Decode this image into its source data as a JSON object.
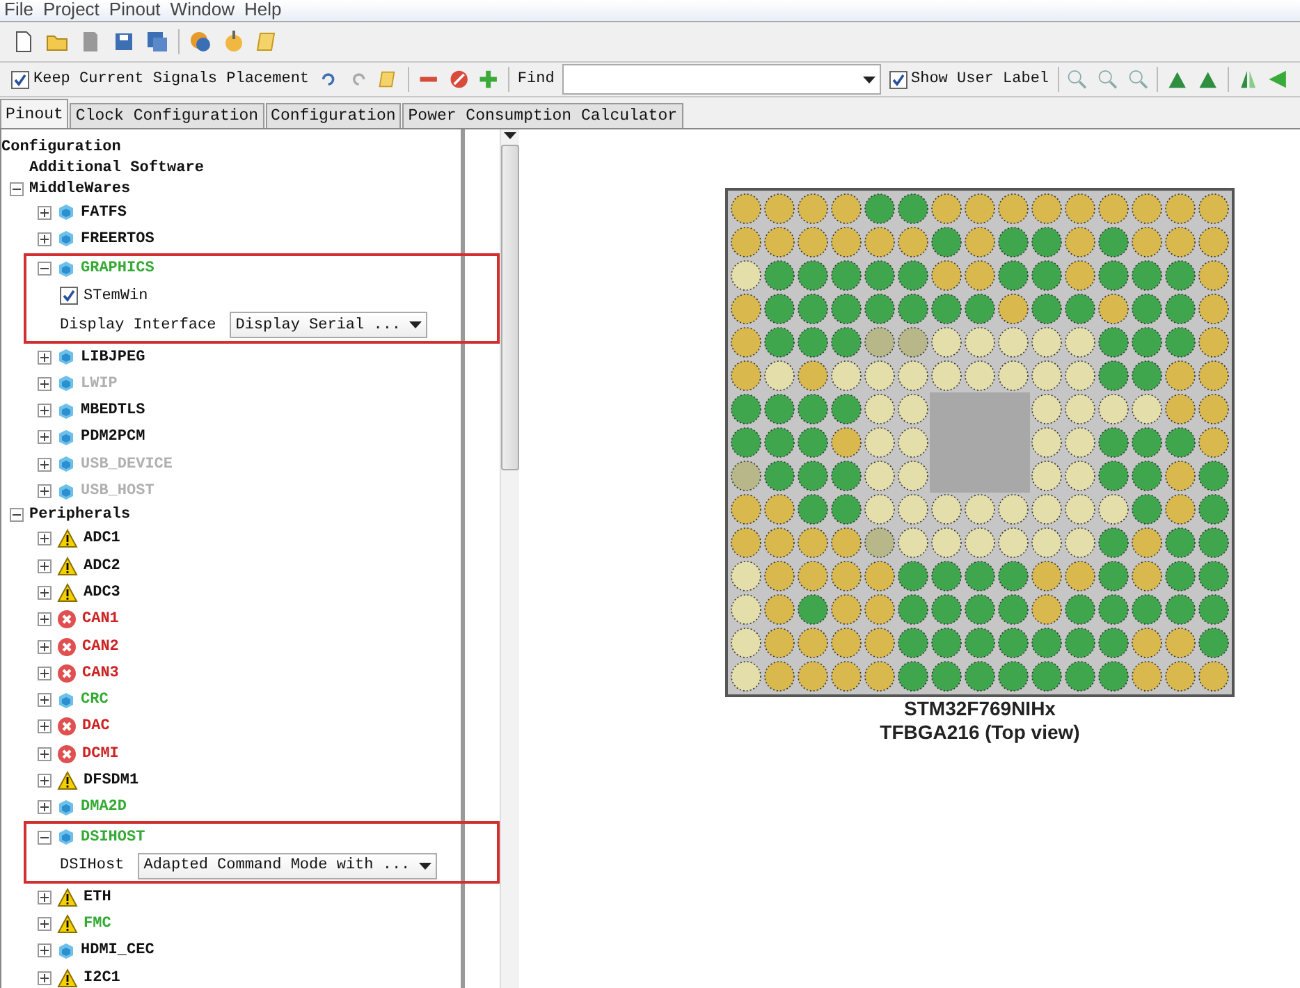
{
  "menu": [
    "File",
    "Project",
    "Pinout",
    "Window",
    "Help"
  ],
  "toolbar": {
    "keep_signals": {
      "label": "Keep Current Signals Placement",
      "checked": true
    },
    "find_label": "Find",
    "show_user_label": {
      "label": "Show User Label",
      "checked": true
    }
  },
  "tabs": [
    {
      "label": "Pinout",
      "selected": true
    },
    {
      "label": "Clock Configuration",
      "selected": false
    },
    {
      "label": "Configuration",
      "selected": false
    },
    {
      "label": "Power Consumption Calculator",
      "selected": false
    }
  ],
  "tree": [
    {
      "label": "Configuration",
      "children": [
        {
          "label": "Additional Software"
        },
        {
          "label": "MiddleWares",
          "expanded": true,
          "children": [
            {
              "label": "FATFS",
              "kind": "cube",
              "color": "#111111",
              "expanded": false
            },
            {
              "label": "FREERTOS",
              "kind": "cube",
              "color": "#111111",
              "expanded": false
            },
            {
              "label": "GRAPHICS",
              "kind": "cube",
              "color": "#33aa33",
              "expanded": true,
              "highlighted": true,
              "children": [
                {
                  "kind": "checkbox",
                  "label": "STemWin",
                  "checked": true
                },
                {
                  "kind": "dropdown",
                  "label": "Display Interface",
                  "value": "Display Serial ..."
                }
              ]
            },
            {
              "label": "LIBJPEG",
              "kind": "cube",
              "color": "#111111",
              "expanded": false
            },
            {
              "label": "LWIP",
              "kind": "cube",
              "color": "#b0b0b0",
              "expanded": false
            },
            {
              "label": "MBEDTLS",
              "kind": "cube",
              "color": "#111111",
              "expanded": false
            },
            {
              "label": "PDM2PCM",
              "kind": "cube",
              "color": "#111111",
              "expanded": false
            },
            {
              "label": "USB_DEVICE",
              "kind": "cube",
              "color": "#b0b0b0",
              "expanded": false
            },
            {
              "label": "USB_HOST",
              "kind": "cube",
              "color": "#b0b0b0",
              "expanded": false
            }
          ]
        },
        {
          "label": "Peripherals",
          "expanded": true,
          "children": [
            {
              "label": "ADC1",
              "kind": "warning",
              "color": "#111111",
              "expanded": false
            },
            {
              "label": "ADC2",
              "kind": "warning",
              "color": "#111111",
              "expanded": false
            },
            {
              "label": "ADC3",
              "kind": "warning",
              "color": "#111111",
              "expanded": false
            },
            {
              "label": "CAN1",
              "kind": "error",
              "color": "#cc2222",
              "expanded": false
            },
            {
              "label": "CAN2",
              "kind": "error",
              "color": "#cc2222",
              "expanded": false
            },
            {
              "label": "CAN3",
              "kind": "error",
              "color": "#cc2222",
              "expanded": false
            },
            {
              "label": "CRC",
              "kind": "cube",
              "color": "#33aa33",
              "expanded": false
            },
            {
              "label": "DAC",
              "kind": "error",
              "color": "#cc2222",
              "expanded": false
            },
            {
              "label": "DCMI",
              "kind": "error",
              "color": "#cc2222",
              "expanded": false
            },
            {
              "label": "DFSDM1",
              "kind": "warning",
              "color": "#111111",
              "expanded": false
            },
            {
              "label": "DMA2D",
              "kind": "cube",
              "color": "#33aa33",
              "expanded": false
            },
            {
              "label": "DSIHOST",
              "kind": "cube",
              "color": "#33aa33",
              "expanded": true,
              "highlighted": true,
              "children": [
                {
                  "kind": "dropdown",
                  "label": "DSIHost",
                  "value": "Adapted Command Mode with ..."
                }
              ]
            },
            {
              "label": "ETH",
              "kind": "warning",
              "color": "#111111",
              "expanded": false
            },
            {
              "label": "FMC",
              "kind": "warning",
              "color": "#33aa33",
              "expanded": false
            },
            {
              "label": "HDMI_CEC",
              "kind": "cube",
              "color": "#111111",
              "expanded": false
            },
            {
              "label": "I2C1",
              "kind": "warning",
              "color": "#111111",
              "expanded": false
            }
          ]
        }
      ]
    }
  ],
  "chip": {
    "pins": [
      [
        {
          "kind": "pin",
          "color": "#d9b84e"
        },
        {
          "kind": "pin",
          "color": "#d9b84e"
        },
        {
          "kind": "pin",
          "color": "#d9b84e"
        },
        {
          "kind": "pin",
          "color": "#d9b84e"
        },
        {
          "kind": "pin",
          "color": "#3fa64e"
        },
        {
          "kind": "pin",
          "color": "#3fa64e"
        },
        {
          "kind": "pin",
          "color": "#d9b84e"
        },
        {
          "kind": "pin",
          "color": "#d9b84e"
        },
        {
          "kind": "pin",
          "color": "#d9b84e"
        },
        {
          "kind": "pin",
          "color": "#d9b84e"
        },
        {
          "kind": "pin",
          "color": "#d9b84e"
        },
        {
          "kind": "pin",
          "color": "#d9b84e"
        },
        {
          "kind": "pin",
          "color": "#d9b84e"
        },
        {
          "kind": "pin",
          "color": "#d9b84e"
        },
        {
          "kind": "pin",
          "color": "#d9b84e"
        }
      ],
      [
        {
          "kind": "pin",
          "color": "#d9b84e"
        },
        {
          "kind": "pin",
          "color": "#d9b84e"
        },
        {
          "kind": "pin",
          "color": "#d9b84e"
        },
        {
          "kind": "pin",
          "color": "#d9b84e"
        },
        {
          "kind": "pin",
          "color": "#d9b84e"
        },
        {
          "kind": "pin",
          "color": "#d9b84e"
        },
        {
          "kind": "pin",
          "color": "#3fa64e"
        },
        {
          "kind": "pin",
          "color": "#d9b84e"
        },
        {
          "kind": "pin",
          "color": "#3fa64e"
        },
        {
          "kind": "pin",
          "color": "#3fa64e"
        },
        {
          "kind": "pin",
          "color": "#d9b84e"
        },
        {
          "kind": "pin",
          "color": "#3fa64e"
        },
        {
          "kind": "pin",
          "color": "#d9b84e"
        },
        {
          "kind": "pin",
          "color": "#d9b84e"
        },
        {
          "kind": "pin",
          "color": "#d9b84e"
        }
      ],
      [
        {
          "kind": "pin",
          "color": "#e3deaa"
        },
        {
          "kind": "pin",
          "color": "#3fa64e"
        },
        {
          "kind": "pin",
          "color": "#3fa64e"
        },
        {
          "kind": "pin",
          "color": "#3fa64e"
        },
        {
          "kind": "pin",
          "color": "#3fa64e"
        },
        {
          "kind": "pin",
          "color": "#3fa64e"
        },
        {
          "kind": "pin",
          "color": "#d9b84e"
        },
        {
          "kind": "pin",
          "color": "#d9b84e"
        },
        {
          "kind": "pin",
          "color": "#3fa64e"
        },
        {
          "kind": "pin",
          "color": "#3fa64e"
        },
        {
          "kind": "pin",
          "color": "#d9b84e"
        },
        {
          "kind": "pin",
          "color": "#3fa64e"
        },
        {
          "kind": "pin",
          "color": "#3fa64e"
        },
        {
          "kind": "pin",
          "color": "#3fa64e"
        },
        {
          "kind": "pin",
          "color": "#d9b84e"
        }
      ],
      [
        {
          "kind": "pin",
          "color": "#d9b84e"
        },
        {
          "kind": "pin",
          "color": "#3fa64e"
        },
        {
          "kind": "pin",
          "color": "#3fa64e"
        },
        {
          "kind": "pin",
          "color": "#3fa64e"
        },
        {
          "kind": "pin",
          "color": "#3fa64e"
        },
        {
          "kind": "pin",
          "color": "#3fa64e"
        },
        {
          "kind": "pin",
          "color": "#3fa64e"
        },
        {
          "kind": "pin",
          "color": "#3fa64e"
        },
        {
          "kind": "pin",
          "color": "#d9b84e"
        },
        {
          "kind": "pin",
          "color": "#3fa64e"
        },
        {
          "kind": "pin",
          "color": "#3fa64e"
        },
        {
          "kind": "pin",
          "color": "#d9b84e"
        },
        {
          "kind": "pin",
          "color": "#3fa64e"
        },
        {
          "kind": "pin",
          "color": "#3fa64e"
        },
        {
          "kind": "pin",
          "color": "#d9b84e"
        }
      ],
      [
        {
          "kind": "pin",
          "color": "#d9b84e"
        },
        {
          "kind": "pin",
          "color": "#3fa64e"
        },
        {
          "kind": "pin",
          "color": "#3fa64e"
        },
        {
          "kind": "pin",
          "color": "#3fa64e"
        },
        {
          "kind": "pin",
          "color": "#b7b78a"
        },
        {
          "kind": "pin",
          "color": "#b7b78a"
        },
        {
          "kind": "pin",
          "color": "#e3deaa"
        },
        {
          "kind": "pin",
          "color": "#e3deaa"
        },
        {
          "kind": "pin",
          "color": "#e3deaa"
        },
        {
          "kind": "pin",
          "color": "#e3deaa"
        },
        {
          "kind": "pin",
          "color": "#e3deaa"
        },
        {
          "kind": "pin",
          "color": "#3fa64e"
        },
        {
          "kind": "pin",
          "color": "#3fa64e"
        },
        {
          "kind": "pin",
          "color": "#3fa64e"
        },
        {
          "kind": "pin",
          "color": "#d9b84e"
        }
      ],
      [
        {
          "kind": "pin",
          "color": "#d9b84e"
        },
        {
          "kind": "pin",
          "color": "#e3deaa"
        },
        {
          "kind": "pin",
          "color": "#d9b84e"
        },
        {
          "kind": "pin",
          "color": "#e3deaa"
        },
        {
          "kind": "pin",
          "color": "#e3deaa"
        },
        {
          "kind": "pin",
          "color": "#e3deaa"
        },
        {
          "kind": "pin",
          "color": "#e3deaa"
        },
        {
          "kind": "pin",
          "color": "#e3deaa"
        },
        {
          "kind": "pin",
          "color": "#e3deaa"
        },
        {
          "kind": "pin",
          "color": "#e3deaa"
        },
        {
          "kind": "pin",
          "color": "#e3deaa"
        },
        {
          "kind": "pin",
          "color": "#3fa64e"
        },
        {
          "kind": "pin",
          "color": "#3fa64e"
        },
        {
          "kind": "pin",
          "color": "#d9b84e"
        },
        {
          "kind": "pin",
          "color": "#d9b84e"
        }
      ],
      [
        {
          "kind": "pin",
          "color": "#3fa64e"
        },
        {
          "kind": "pin",
          "color": "#3fa64e"
        },
        {
          "kind": "pin",
          "color": "#3fa64e"
        },
        {
          "kind": "pin",
          "color": "#3fa64e"
        },
        {
          "kind": "pin",
          "color": "#e3deaa"
        },
        {
          "kind": "pin",
          "color": "#e3deaa"
        },
        {
          "kind": "gap"
        },
        {
          "kind": "gap"
        },
        {
          "kind": "gap"
        },
        {
          "kind": "pin",
          "color": "#e3deaa"
        },
        {
          "kind": "pin",
          "color": "#e3deaa"
        },
        {
          "kind": "pin",
          "color": "#e3deaa"
        },
        {
          "kind": "pin",
          "color": "#e3deaa"
        },
        {
          "kind": "pin",
          "color": "#d9b84e"
        },
        {
          "kind": "pin",
          "color": "#d9b84e"
        }
      ],
      [
        {
          "kind": "pin",
          "color": "#3fa64e"
        },
        {
          "kind": "pin",
          "color": "#3fa64e"
        },
        {
          "kind": "pin",
          "color": "#3fa64e"
        },
        {
          "kind": "pin",
          "color": "#d9b84e"
        },
        {
          "kind": "pin",
          "color": "#e3deaa"
        },
        {
          "kind": "pin",
          "color": "#e3deaa"
        },
        {
          "kind": "gap"
        },
        {
          "kind": "gap"
        },
        {
          "kind": "gap"
        },
        {
          "kind": "pin",
          "color": "#e3deaa"
        },
        {
          "kind": "pin",
          "color": "#e3deaa"
        },
        {
          "kind": "pin",
          "color": "#3fa64e"
        },
        {
          "kind": "pin",
          "color": "#3fa64e"
        },
        {
          "kind": "pin",
          "color": "#3fa64e"
        },
        {
          "kind": "pin",
          "color": "#d9b84e"
        }
      ],
      [
        {
          "kind": "pin",
          "color": "#b7b78a"
        },
        {
          "kind": "pin",
          "color": "#3fa64e"
        },
        {
          "kind": "pin",
          "color": "#3fa64e"
        },
        {
          "kind": "pin",
          "color": "#3fa64e"
        },
        {
          "kind": "pin",
          "color": "#e3deaa"
        },
        {
          "kind": "pin",
          "color": "#e3deaa"
        },
        {
          "kind": "gap"
        },
        {
          "kind": "gap"
        },
        {
          "kind": "gap"
        },
        {
          "kind": "pin",
          "color": "#e3deaa"
        },
        {
          "kind": "pin",
          "color": "#e3deaa"
        },
        {
          "kind": "pin",
          "color": "#3fa64e"
        },
        {
          "kind": "pin",
          "color": "#3fa64e"
        },
        {
          "kind": "pin",
          "color": "#d9b84e"
        },
        {
          "kind": "pin",
          "color": "#3fa64e"
        }
      ],
      [
        {
          "kind": "pin",
          "color": "#d9b84e"
        },
        {
          "kind": "pin",
          "color": "#d9b84e"
        },
        {
          "kind": "pin",
          "color": "#3fa64e"
        },
        {
          "kind": "pin",
          "color": "#3fa64e"
        },
        {
          "kind": "pin",
          "color": "#e3deaa"
        },
        {
          "kind": "pin",
          "color": "#e3deaa"
        },
        {
          "kind": "pin",
          "color": "#e3deaa"
        },
        {
          "kind": "pin",
          "color": "#e3deaa"
        },
        {
          "kind": "pin",
          "color": "#e3deaa"
        },
        {
          "kind": "pin",
          "color": "#e3deaa"
        },
        {
          "kind": "pin",
          "color": "#e3deaa"
        },
        {
          "kind": "pin",
          "color": "#e3deaa"
        },
        {
          "kind": "pin",
          "color": "#3fa64e"
        },
        {
          "kind": "pin",
          "color": "#d9b84e"
        },
        {
          "kind": "pin",
          "color": "#3fa64e"
        }
      ],
      [
        {
          "kind": "pin",
          "color": "#d9b84e"
        },
        {
          "kind": "pin",
          "color": "#d9b84e"
        },
        {
          "kind": "pin",
          "color": "#d9b84e"
        },
        {
          "kind": "pin",
          "color": "#d9b84e"
        },
        {
          "kind": "pin",
          "color": "#b7b78a"
        },
        {
          "kind": "pin",
          "color": "#e3deaa"
        },
        {
          "kind": "pin",
          "color": "#e3deaa"
        },
        {
          "kind": "pin",
          "color": "#e3deaa"
        },
        {
          "kind": "pin",
          "color": "#e3deaa"
        },
        {
          "kind": "pin",
          "color": "#e3deaa"
        },
        {
          "kind": "pin",
          "color": "#e3deaa"
        },
        {
          "kind": "pin",
          "color": "#3fa64e"
        },
        {
          "kind": "pin",
          "color": "#d9b84e"
        },
        {
          "kind": "pin",
          "color": "#3fa64e"
        },
        {
          "kind": "pin",
          "color": "#3fa64e"
        }
      ],
      [
        {
          "kind": "pin",
          "color": "#e3deaa"
        },
        {
          "kind": "pin",
          "color": "#d9b84e"
        },
        {
          "kind": "pin",
          "color": "#d9b84e"
        },
        {
          "kind": "pin",
          "color": "#d9b84e"
        },
        {
          "kind": "pin",
          "color": "#d9b84e"
        },
        {
          "kind": "pin",
          "color": "#3fa64e"
        },
        {
          "kind": "pin",
          "color": "#3fa64e"
        },
        {
          "kind": "pin",
          "color": "#3fa64e"
        },
        {
          "kind": "pin",
          "color": "#3fa64e"
        },
        {
          "kind": "pin",
          "color": "#d9b84e"
        },
        {
          "kind": "pin",
          "color": "#d9b84e"
        },
        {
          "kind": "pin",
          "color": "#3fa64e"
        },
        {
          "kind": "pin",
          "color": "#d9b84e"
        },
        {
          "kind": "pin",
          "color": "#3fa64e"
        },
        {
          "kind": "pin",
          "color": "#3fa64e"
        }
      ],
      [
        {
          "kind": "pin",
          "color": "#e3deaa"
        },
        {
          "kind": "pin",
          "color": "#d9b84e"
        },
        {
          "kind": "pin",
          "color": "#3fa64e"
        },
        {
          "kind": "pin",
          "color": "#d9b84e"
        },
        {
          "kind": "pin",
          "color": "#d9b84e"
        },
        {
          "kind": "pin",
          "color": "#3fa64e"
        },
        {
          "kind": "pin",
          "color": "#3fa64e"
        },
        {
          "kind": "pin",
          "color": "#3fa64e"
        },
        {
          "kind": "pin",
          "color": "#3fa64e"
        },
        {
          "kind": "pin",
          "color": "#d9b84e"
        },
        {
          "kind": "pin",
          "color": "#3fa64e"
        },
        {
          "kind": "pin",
          "color": "#3fa64e"
        },
        {
          "kind": "pin",
          "color": "#3fa64e"
        },
        {
          "kind": "pin",
          "color": "#3fa64e"
        },
        {
          "kind": "pin",
          "color": "#3fa64e"
        }
      ],
      [
        {
          "kind": "pin",
          "color": "#e3deaa"
        },
        {
          "kind": "pin",
          "color": "#d9b84e"
        },
        {
          "kind": "pin",
          "color": "#d9b84e"
        },
        {
          "kind": "pin",
          "color": "#d9b84e"
        },
        {
          "kind": "pin",
          "color": "#d9b84e"
        },
        {
          "kind": "pin",
          "color": "#3fa64e"
        },
        {
          "kind": "pin",
          "color": "#3fa64e"
        },
        {
          "kind": "pin",
          "color": "#3fa64e"
        },
        {
          "kind": "pin",
          "color": "#3fa64e"
        },
        {
          "kind": "pin",
          "color": "#3fa64e"
        },
        {
          "kind": "pin",
          "color": "#3fa64e"
        },
        {
          "kind": "pin",
          "color": "#3fa64e"
        },
        {
          "kind": "pin",
          "color": "#d9b84e"
        },
        {
          "kind": "pin",
          "color": "#d9b84e"
        },
        {
          "kind": "pin",
          "color": "#3fa64e"
        }
      ],
      [
        {
          "kind": "pin",
          "color": "#e3deaa"
        },
        {
          "kind": "pin",
          "color": "#d9b84e"
        },
        {
          "kind": "pin",
          "color": "#d9b84e"
        },
        {
          "kind": "pin",
          "color": "#d9b84e"
        },
        {
          "kind": "pin",
          "color": "#d9b84e"
        },
        {
          "kind": "pin",
          "color": "#3fa64e"
        },
        {
          "kind": "pin",
          "color": "#3fa64e"
        },
        {
          "kind": "pin",
          "color": "#3fa64e"
        },
        {
          "kind": "pin",
          "color": "#3fa64e"
        },
        {
          "kind": "pin",
          "color": "#3fa64e"
        },
        {
          "kind": "pin",
          "color": "#3fa64e"
        },
        {
          "kind": "pin",
          "color": "#3fa64e"
        },
        {
          "kind": "pin",
          "color": "#d9b84e"
        },
        {
          "kind": "pin",
          "color": "#d9b84e"
        },
        {
          "kind": "pin",
          "color": "#d9b84e"
        }
      ]
    ],
    "name": "STM32F769NIHx",
    "package": "TFBGA216 (Top view)"
  }
}
